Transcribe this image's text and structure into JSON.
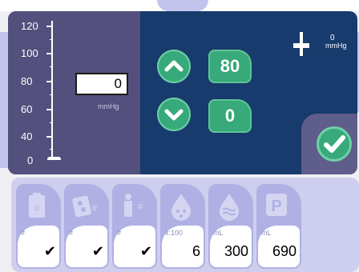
{
  "pressure": {
    "scale_ticks": [
      "120",
      "100",
      "80",
      "60",
      "40",
      "0"
    ],
    "value": "0",
    "unit": "mmHg"
  },
  "controls": {
    "upper_value": "80",
    "lower_value": "0"
  },
  "gauge": {
    "value": "0",
    "unit": "mmHg"
  },
  "tray": {
    "items": [
      {
        "id": "order",
        "label": "#",
        "value": "✔",
        "icon": "clipboard-icon"
      },
      {
        "id": "device",
        "label": "#",
        "value": "✔",
        "icon": "device-icon"
      },
      {
        "id": "patient",
        "label": "#",
        "value": "✔",
        "icon": "patient-icon"
      },
      {
        "id": "drops",
        "label": "x:100",
        "value": "6",
        "icon": "drops-icon"
      },
      {
        "id": "fluid",
        "label": "mL",
        "value": "300",
        "icon": "fluid-drop-icon"
      },
      {
        "id": "parking",
        "label": "mL",
        "value": "690",
        "icon": "parking-icon"
      }
    ]
  },
  "colors": {
    "panel_blue": "#173b6c",
    "panel_purple": "#53507d",
    "accent_green": "#37a97a",
    "tray_bg": "#cecfee"
  }
}
